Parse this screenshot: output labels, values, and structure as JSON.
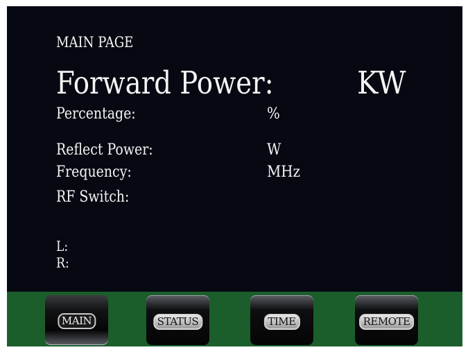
{
  "screen": {
    "page_title": "MAIN PAGE",
    "forward_power": {
      "label": "Forward Power:",
      "unit": "KW"
    },
    "rows": {
      "percentage": {
        "label": "Percentage:",
        "unit": "%"
      },
      "reflect_power": {
        "label": "Reflect Power:",
        "unit": "W"
      },
      "frequency": {
        "label": "Frequency:",
        "unit": "MHz"
      },
      "rf_switch": {
        "label": "RF Switch:"
      },
      "l": {
        "label": "L:"
      },
      "r": {
        "label": "R:"
      }
    }
  },
  "nav": {
    "main": "MAIN",
    "status": "STATUS",
    "time": "TIME",
    "remote": "REMOTE",
    "active": "MAIN"
  },
  "colors": {
    "frame": "#1b5e2b",
    "screen": "#060912",
    "text": "#f4f4f4"
  }
}
